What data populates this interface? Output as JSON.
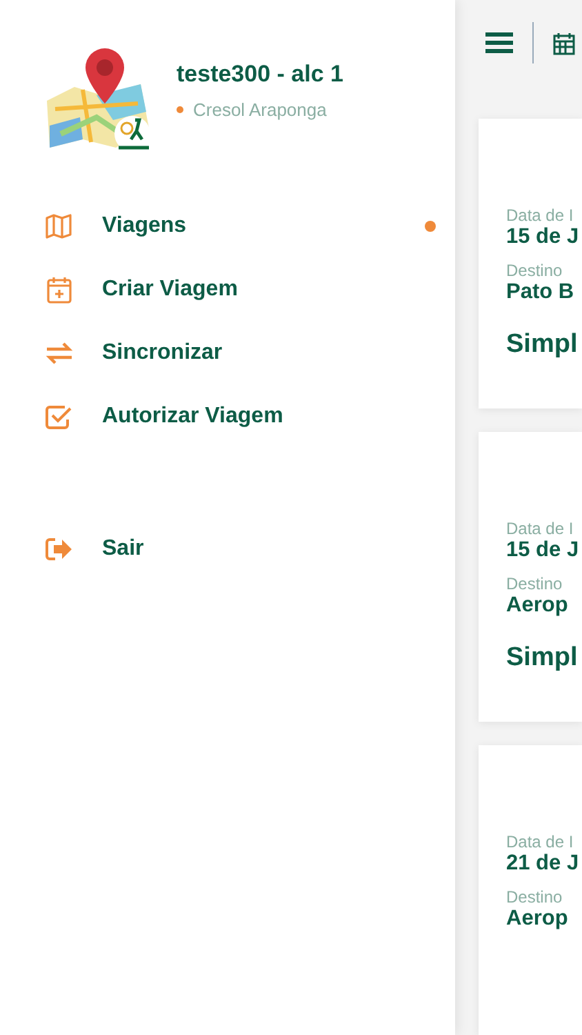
{
  "profile": {
    "name": "teste300 - alc 1",
    "organization": "Cresol Araponga"
  },
  "menu": [
    {
      "label": "Viagens",
      "selected": true
    },
    {
      "label": "Criar Viagem",
      "selected": false
    },
    {
      "label": "Sincronizar",
      "selected": false
    },
    {
      "label": "Autorizar Viagem",
      "selected": false
    }
  ],
  "logout": {
    "label": "Sair"
  },
  "trips": [
    {
      "date_label": "Data de I",
      "date": "15 de J",
      "destination_label": "Destino",
      "destination": "Pato B",
      "type": "Simpl"
    },
    {
      "date_label": "Data de I",
      "date": "15 de J",
      "destination_label": "Destino",
      "destination": "Aerop",
      "type": "Simpl"
    },
    {
      "date_label": "Data de I",
      "date": "21 de J",
      "destination_label": "Destino",
      "destination": "Aerop"
    }
  ]
}
